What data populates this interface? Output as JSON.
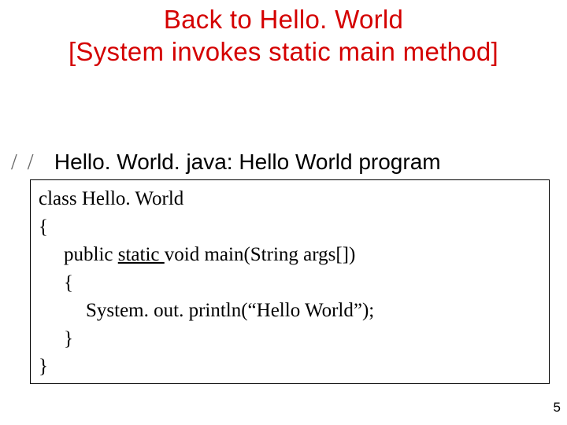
{
  "title": {
    "line1": "Back to Hello. World",
    "line2": "[System invokes static main method]"
  },
  "comment": {
    "slashes": "/ /",
    "text": "Hello. World. java: Hello World program"
  },
  "code": {
    "l1": "class Hello. World",
    "l2": "{",
    "l3_a": "public ",
    "l3_b": "static ",
    "l3_c": "void main(String args[])",
    "l4": "{",
    "l5": "System. out. println(“Hello World”);",
    "l6": "}",
    "l7": "}"
  },
  "page_number": "5"
}
